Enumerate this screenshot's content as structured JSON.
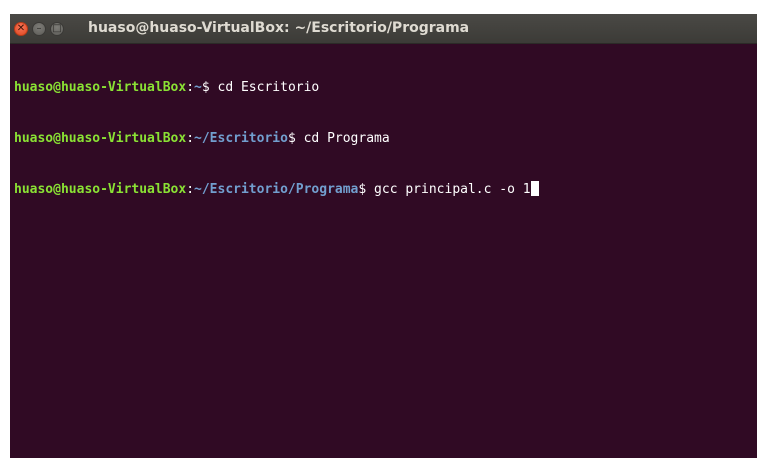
{
  "window": {
    "title": "huaso@huaso-VirtualBox: ~/Escritorio/Programa",
    "close_glyph": "✕",
    "minimize_glyph": "–",
    "maximize_glyph": "□",
    "colors": {
      "background": "#300a24",
      "user_host": "#8ae234",
      "path": "#729fcf",
      "text": "#ffffff"
    }
  },
  "terminal": {
    "lines": [
      {
        "user_host": "huaso@huaso-VirtualBox",
        "colon": ":",
        "path": "~",
        "prompt_symbol": "$ ",
        "command": "cd Escritorio"
      },
      {
        "user_host": "huaso@huaso-VirtualBox",
        "colon": ":",
        "path": "~/Escritorio",
        "prompt_symbol": "$ ",
        "command": "cd Programa"
      },
      {
        "user_host": "huaso@huaso-VirtualBox",
        "colon": ":",
        "path": "~/Escritorio/Programa",
        "prompt_symbol": "$ ",
        "command": "gcc principal.c -o 1"
      }
    ]
  }
}
